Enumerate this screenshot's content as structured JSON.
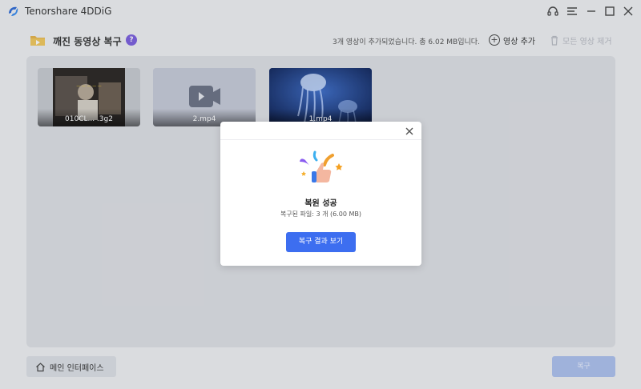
{
  "app": {
    "title": "Tenorshare 4DDiG"
  },
  "header": {
    "title": "깨진 동영상 복구",
    "summary": "3개 영상이 추가되었습니다. 총 6.02 MB입니다.",
    "add_label": "영상 추가",
    "delete_label": "모든 영상 제거"
  },
  "videos": [
    {
      "name": "010CL... .3g2"
    },
    {
      "name": "2.mp4"
    },
    {
      "name": "1.mp4"
    }
  ],
  "modal": {
    "title": "복원 성공",
    "subtitle": "복구된 파일: 3 개 (6.00 MB)",
    "button": "복구 결과 보기"
  },
  "footer": {
    "home_label": "메인 인터페이스",
    "recover_label": "복구"
  },
  "colors": {
    "accent": "#3d6ef0",
    "help": "#7b5fe0"
  }
}
